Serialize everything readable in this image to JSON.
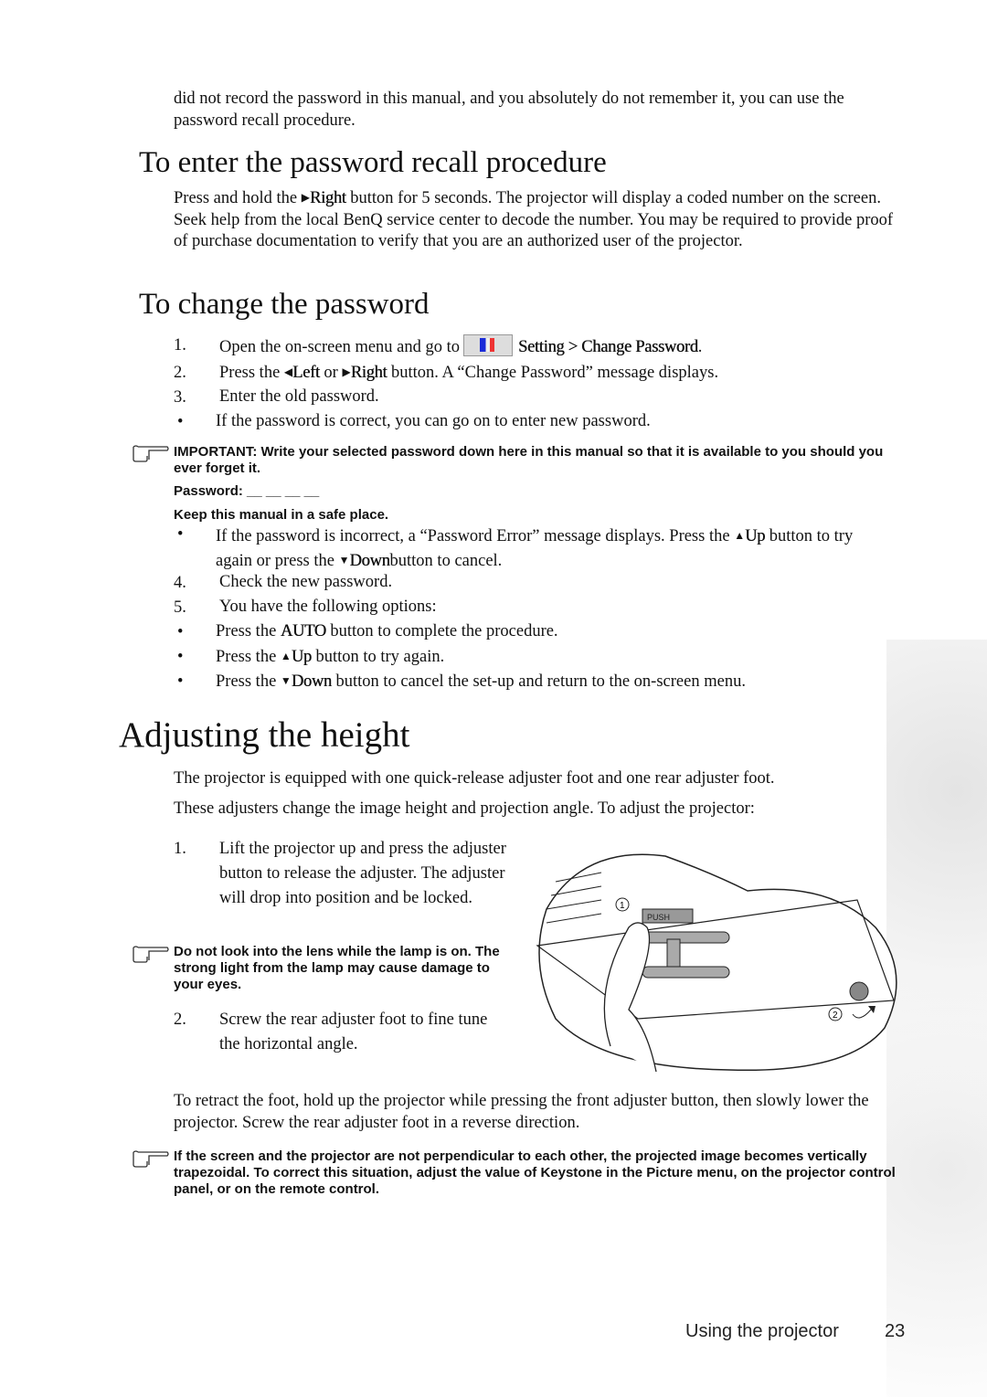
{
  "intro": "did not record the password in this manual, and you absolutely do not remember it, you can use the password recall procedure.",
  "recall": {
    "heading": "To enter the password recall procedure",
    "pre": "Press and hold the",
    "key": "Right",
    "post": "button for 5 seconds. The projector will display a coded number on the screen. Seek help from the local BenQ service center to decode the number. You may be required to provide proof of purchase documentation to verify that you are an authorized user of the projector."
  },
  "change": {
    "heading": "To change the password",
    "steps": [
      {
        "num": "1.",
        "pre": "Open the on-screen menu and go to",
        "path": "Setting > Change Password",
        "post": "."
      },
      {
        "num": "2.",
        "pre": "Press the",
        "k1": "Left",
        "mid": "or",
        "k2": "Right",
        "post": "button. A “Change Password” message displays."
      },
      {
        "num": "3.",
        "text": "Enter the old password."
      }
    ],
    "bullet_correct": "If the password is correct, you can go on to enter new password.",
    "note": {
      "text": "IMPORTANT: Write your selected password down here in this manual so that it is available to you should you ever forget it.",
      "password_label": "Password: __ __ __ __",
      "keep": "Keep this manual in a safe place."
    },
    "bullet_incorrect": {
      "pre": "If the password is incorrect, a “Password Error” message displays. Press the",
      "k1": "Up",
      "mid": "button to try again or press the",
      "k2": "Down",
      "post": "button to cancel."
    },
    "step4": {
      "num": "4.",
      "text": "Check the new password."
    },
    "step5": {
      "num": "5.",
      "text": "You have the following options:"
    },
    "options": [
      {
        "pre": "Press the",
        "key": "AUTO",
        "post": "button to complete the procedure."
      },
      {
        "pre": "Press the",
        "key": "Up",
        "post": "button to try again."
      },
      {
        "pre": "Press the",
        "key": "Down",
        "post": "button to cancel the set-up and return to the on-screen menu."
      }
    ]
  },
  "height": {
    "heading": "Adjusting the height",
    "p1": "The projector is equipped with one quick-release adjuster foot and one rear adjuster foot.",
    "p2": "These adjusters change the image height and projection angle. To adjust the projector:",
    "step1": {
      "num": "1.",
      "text": "Lift the projector up and press the adjuster button to release the adjuster. The adjuster will drop into position and be locked."
    },
    "note": "Do not look into the lens while the lamp is on. The strong light from the lamp may cause damage to your eyes.",
    "step2": {
      "num": "2.",
      "text": "Screw the rear adjuster foot to fine tune the horizontal angle."
    },
    "figure": {
      "push_label": "PUSH",
      "callout1": "1",
      "callout2": "2"
    },
    "retract": "To retract the foot, hold up the projector while pressing the front adjuster button, then slowly lower the projector. Screw the rear adjuster foot in a reverse direction.",
    "note2": "If the screen and the projector are not perpendicular to each other, the projected image becomes vertically trapezoidal. To correct this situation, adjust the value of Keystone in the Picture menu, on the projector control panel, or on the remote control."
  },
  "footer": {
    "section": "Using the projector",
    "page": "23"
  },
  "icons": {
    "note": "pointing-hand-icon",
    "menu": "setting-menu-icon",
    "left": "triangle-left",
    "right": "triangle-right",
    "up": "triangle-up",
    "down": "triangle-down"
  }
}
